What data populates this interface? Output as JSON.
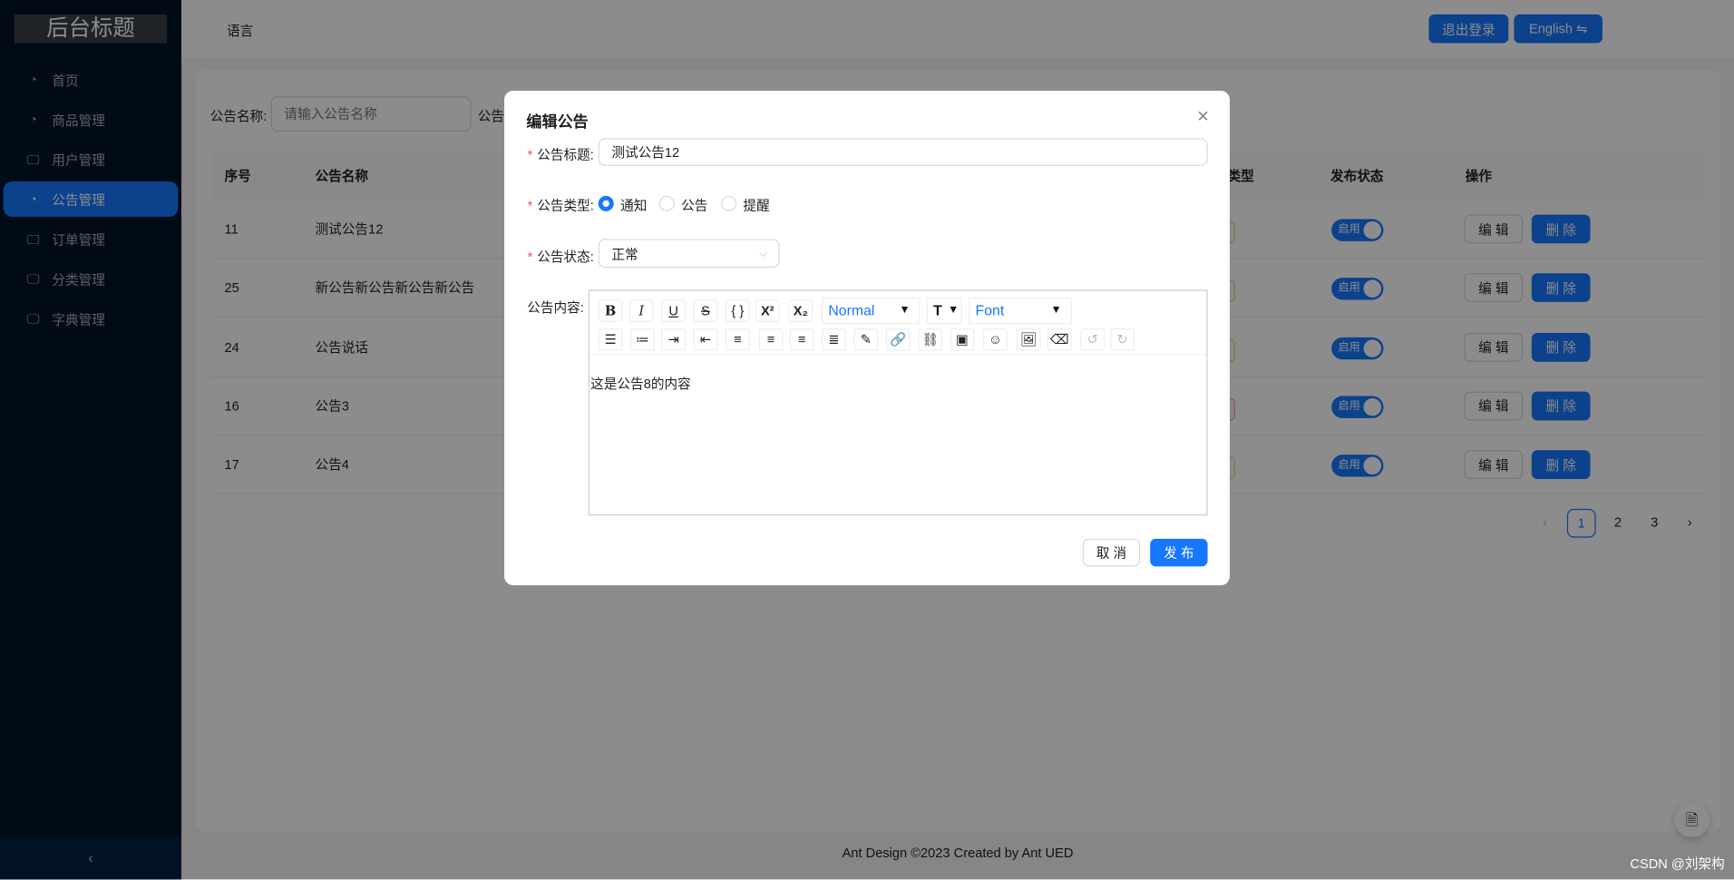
{
  "sidebar": {
    "logo": "后台标题",
    "collapse_icon": "‹",
    "items": [
      {
        "label": "首页",
        "icon": "pie-chart-icon"
      },
      {
        "label": "商品管理",
        "icon": "pie-chart-icon"
      },
      {
        "label": "用户管理",
        "icon": "desktop-icon"
      },
      {
        "label": "公告管理",
        "icon": "pie-chart-icon",
        "selected": true
      },
      {
        "label": "订单管理",
        "icon": "desktop-icon"
      },
      {
        "label": "分类管理",
        "icon": "desktop-icon"
      },
      {
        "label": "字典管理",
        "icon": "desktop-icon"
      }
    ]
  },
  "header": {
    "language": "语言",
    "logout": "退出登录",
    "english": "English ⇋"
  },
  "search": {
    "label": "公告名称:",
    "placeholder": "请输入公告名称",
    "label2": "公告"
  },
  "table": {
    "columns": [
      "序号",
      "公告名称",
      "类型",
      "发布状态",
      "操作"
    ],
    "rows": [
      {
        "id": "11",
        "name": "测试公告12",
        "tag_color": "green",
        "status": "启用",
        "enabled": true
      },
      {
        "id": "25",
        "name": "新公告新公告新公告新公告",
        "tag_color": "green",
        "status": "启用",
        "enabled": true
      },
      {
        "id": "24",
        "name": "公告说话",
        "tag_color": "green",
        "status": "启用",
        "enabled": true
      },
      {
        "id": "16",
        "name": "公告3",
        "tag_color": "red",
        "status": "启用",
        "enabled": true
      },
      {
        "id": "17",
        "name": "公告4",
        "tag_color": "green",
        "status": "启用",
        "enabled": true
      }
    ],
    "edit": "编 辑",
    "delete": "删 除"
  },
  "pagination": {
    "prev": "‹",
    "pages": [
      "1",
      "2",
      "3"
    ],
    "current": "1",
    "next": "›"
  },
  "footer": "Ant Design ©2023 Created by Ant UED",
  "watermark": "CSDN @刘架构",
  "modal": {
    "title": "编辑公告",
    "close": "✕",
    "title_label": "公告标题:",
    "title_value": "测试公告12",
    "type_label": "公告类型:",
    "types": [
      "通知",
      "公告",
      "提醒"
    ],
    "type_selected": "通知",
    "status_label": "公告状态:",
    "status_value": "正常",
    "content_label": "公告内容:",
    "content": "这是公告8的内容",
    "heading_select": "Normal",
    "font_select": "Font",
    "cancel": "取 消",
    "publish": "发 布"
  },
  "colors": {
    "primary": "#1677ff",
    "sidebar": "#001529"
  }
}
